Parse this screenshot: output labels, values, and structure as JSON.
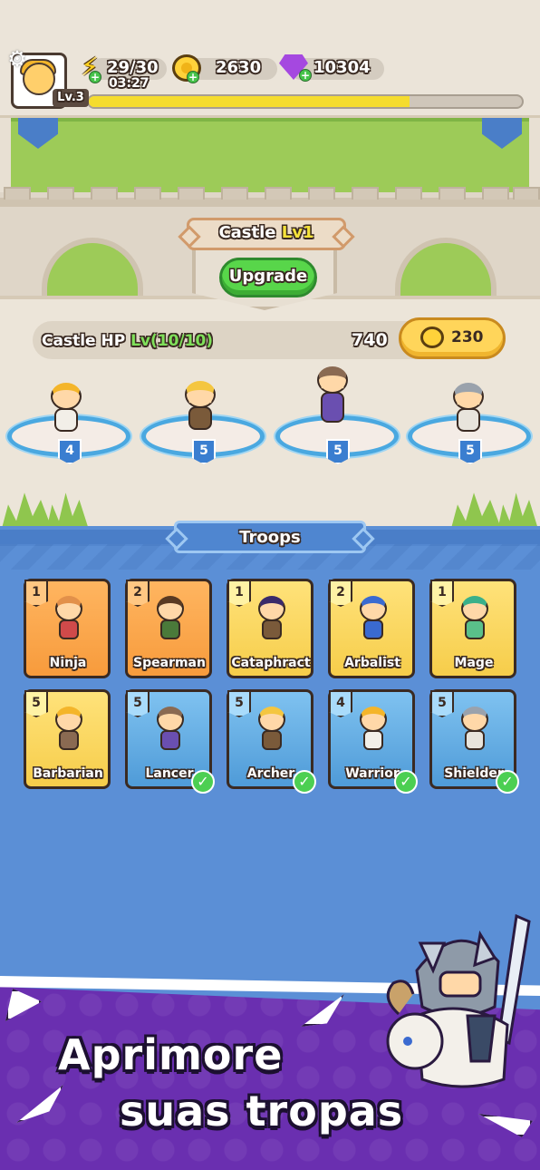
{
  "hud": {
    "level": "Lv.3",
    "energy": "29/30",
    "energy_timer": "03:27",
    "coins": "2630",
    "gems": "10304",
    "xp_fraction": 0.74
  },
  "castle": {
    "title": "Castle",
    "level": "Lv1",
    "upgrade_label": "Upgrade",
    "hp_label": "Castle HP",
    "hp_level": "Lv(10/10)",
    "hp_value": "740",
    "upgrade_cost": "230"
  },
  "battle_slots": [
    {
      "level": "4",
      "hero": "warrior"
    },
    {
      "level": "5",
      "hero": "archer"
    },
    {
      "level": "5",
      "hero": "lancer"
    },
    {
      "level": "5",
      "hero": "shielder"
    }
  ],
  "troops": {
    "title": "Troops",
    "cards": [
      {
        "name": "Ninja",
        "level": "1",
        "rarity": "orange",
        "equipped": false
      },
      {
        "name": "Spearman",
        "level": "2",
        "rarity": "orange",
        "equipped": false
      },
      {
        "name": "Cataphract",
        "level": "1",
        "rarity": "yellow",
        "equipped": false
      },
      {
        "name": "Arbalist",
        "level": "2",
        "rarity": "yellow",
        "equipped": false
      },
      {
        "name": "Mage",
        "level": "1",
        "rarity": "yellow",
        "equipped": false
      },
      {
        "name": "Barbarian",
        "level": "5",
        "rarity": "yellow",
        "equipped": false
      },
      {
        "name": "Lancer",
        "level": "5",
        "rarity": "blue",
        "equipped": true
      },
      {
        "name": "Archer",
        "level": "5",
        "rarity": "blue",
        "equipped": true
      },
      {
        "name": "Warrior",
        "level": "4",
        "rarity": "blue",
        "equipped": true
      },
      {
        "name": "Shielder",
        "level": "5",
        "rarity": "blue",
        "equipped": true
      }
    ]
  },
  "promo": {
    "line1": "Aprimore",
    "line2": "suas tropas"
  },
  "colors": {
    "panel": "#5b8fd6",
    "promo": "#6a2fb0",
    "upgrade_green": "#58d64a",
    "xp_yellow": "#f5dc2e"
  }
}
